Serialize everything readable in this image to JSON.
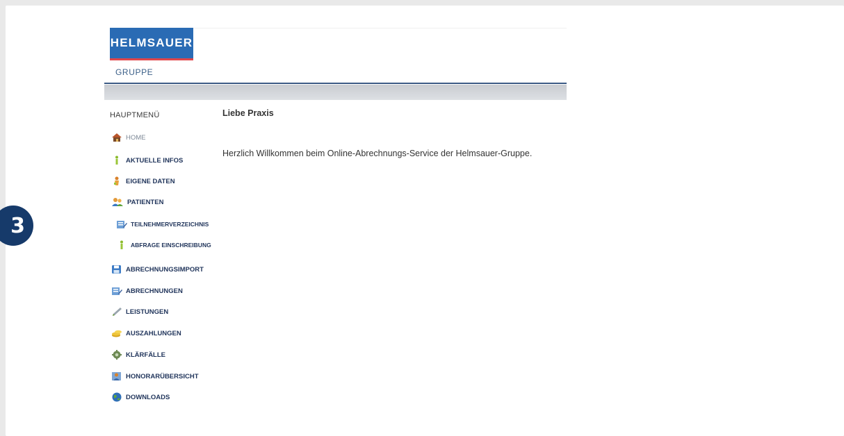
{
  "step_badge": "3",
  "brand": {
    "logo_text": "HELMSAUER",
    "logo_sub": "GRUPPE",
    "colors": {
      "logo_bg": "#2a6bb4",
      "logo_underline": "#e0464a",
      "header_rule": "#3b5a85",
      "menu_text": "#22365c"
    }
  },
  "menu": {
    "title": "HAUPTMENÜ",
    "items": [
      {
        "label": "HOME",
        "icon": "house-icon"
      },
      {
        "label": "AKTUELLE INFOS",
        "icon": "info-icon"
      },
      {
        "label": "EIGENE DATEN",
        "icon": "person-data-icon"
      },
      {
        "label": "PATIENTEN",
        "icon": "patients-icon"
      },
      {
        "label": "TEILNEHMERVERZEICHNIS",
        "icon": "directory-icon"
      },
      {
        "label": "ABFRAGE EINSCHREIBUNG",
        "icon": "info-icon"
      },
      {
        "label": "ABRECHNUNGSIMPORT",
        "icon": "floppy-disk-icon"
      },
      {
        "label": "ABRECHNUNGEN",
        "icon": "document-edit-icon"
      },
      {
        "label": "LEISTUNGEN",
        "icon": "pen-icon"
      },
      {
        "label": "AUSZAHLUNGEN",
        "icon": "coins-icon"
      },
      {
        "label": "KLÄRFÄLLE",
        "icon": "gear-icon"
      },
      {
        "label": "HONORARÜBERSICHT",
        "icon": "overview-icon"
      },
      {
        "label": "DOWNLOADS",
        "icon": "globe-icon"
      }
    ]
  },
  "content": {
    "title": "Liebe Praxis",
    "text": "Herzlich Willkommen beim Online-Abrechnungs-Service der Helmsauer-Gruppe."
  }
}
